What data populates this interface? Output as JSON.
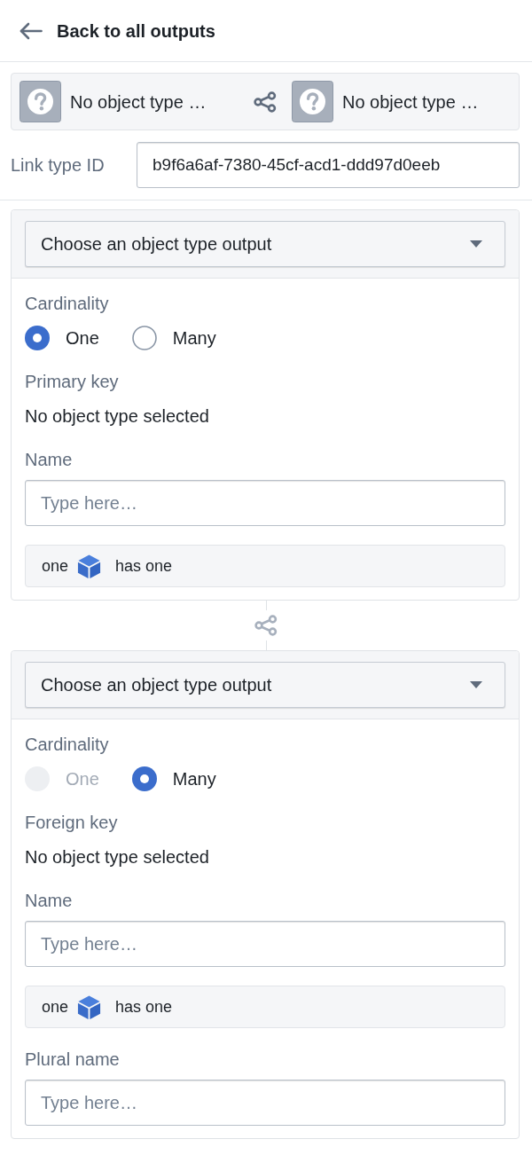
{
  "header": {
    "back_label": "Back to all outputs"
  },
  "link_ends": [
    {
      "label": "No object type …"
    },
    {
      "label": "No object type …"
    }
  ],
  "link_type_id": {
    "label": "Link type ID",
    "value": "b9f6a6af-7380-45cf-acd1-ddd97d0eeb"
  },
  "sides": [
    {
      "select": {
        "label": "Choose an object type output"
      },
      "cardinality": {
        "label": "Cardinality",
        "options": [
          {
            "label": "One",
            "selected": true,
            "disabled": false
          },
          {
            "label": "Many",
            "selected": false,
            "disabled": false
          }
        ]
      },
      "key": {
        "label": "Primary key",
        "value": "No object type selected"
      },
      "items": [
        {
          "kind": "field",
          "label": "Name",
          "placeholder": "Type here…"
        },
        {
          "kind": "summary",
          "before": "one",
          "after": "has one"
        }
      ]
    },
    {
      "select": {
        "label": "Choose an object type output"
      },
      "cardinality": {
        "label": "Cardinality",
        "options": [
          {
            "label": "One",
            "selected": false,
            "disabled": true
          },
          {
            "label": "Many",
            "selected": true,
            "disabled": false
          }
        ]
      },
      "key": {
        "label": "Foreign key",
        "value": "No object type selected"
      },
      "items": [
        {
          "kind": "field",
          "label": "Name",
          "placeholder": "Type here…"
        },
        {
          "kind": "summary",
          "before": "one",
          "after": "has one"
        },
        {
          "kind": "field",
          "label": "Plural name",
          "placeholder": "Type here…"
        }
      ]
    }
  ]
}
